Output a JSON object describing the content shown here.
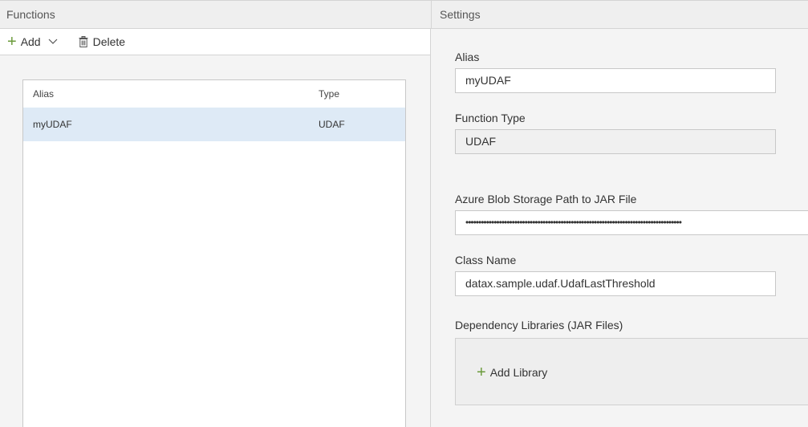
{
  "panels": {
    "functions_title": "Functions",
    "settings_title": "Settings"
  },
  "toolbar": {
    "add_label": "Add",
    "delete_label": "Delete"
  },
  "table": {
    "headers": {
      "alias": "Alias",
      "type": "Type"
    },
    "rows": [
      {
        "alias": "myUDAF",
        "type": "UDAF"
      }
    ]
  },
  "settings": {
    "alias_label": "Alias",
    "alias_value": "myUDAF",
    "function_type_label": "Function Type",
    "function_type_value": "UDAF",
    "jar_path_label": "Azure Blob Storage Path to JAR File",
    "jar_path_value": "••••••••••••••••••••••••••••••••••••••••••••••••••••••••••••••••••••••••••••••••••••",
    "class_name_label": "Class Name",
    "class_name_value": "datax.sample.udaf.UdafLastThreshold",
    "dependency_label": "Dependency Libraries (JAR Files)",
    "add_library_label": "Add Library"
  },
  "colors": {
    "accent_green": "#6a9a3a",
    "selected_row": "#deeaf6",
    "header_bg": "#efefef"
  },
  "icons": {
    "add": "plus-icon",
    "add_menu": "chevron-down-icon",
    "delete": "trash-icon",
    "add_library": "plus-icon"
  }
}
